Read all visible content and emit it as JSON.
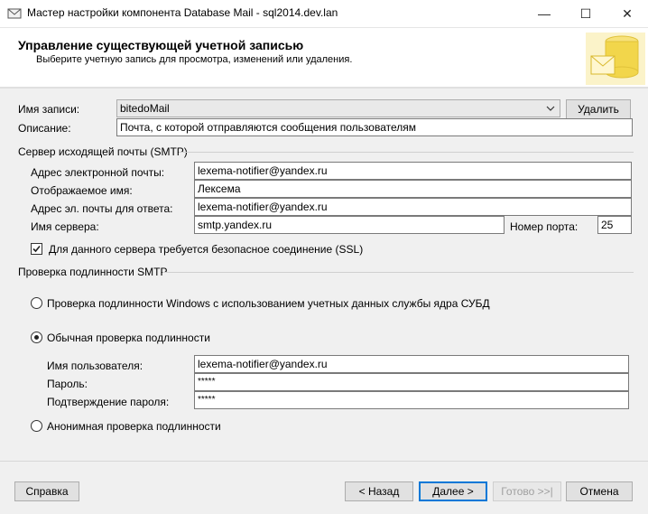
{
  "window": {
    "title": "Мастер настройки компонента Database Mail - sql2014.dev.lan",
    "minimize_glyph": "—",
    "maximize_glyph": "☐",
    "close_glyph": "✕"
  },
  "header": {
    "title": "Управление существующей учетной записью",
    "subtitle": "Выберите учетную запись для просмотра, изменений или удаления."
  },
  "account": {
    "name_label": "Имя записи:",
    "name_value": "bitedoMail",
    "delete_label": "Удалить",
    "description_label": "Описание:",
    "description_value": "Почта, с которой отправляются сообщения пользователям"
  },
  "smtp": {
    "group_label": "Сервер исходящей почты (SMTP)",
    "email_label": "Адрес электронной почты:",
    "email_value": "lexema-notifier@yandex.ru",
    "display_name_label": "Отображаемое имя:",
    "display_name_value": "Лексема",
    "reply_label": "Адрес эл. почты для ответа:",
    "reply_value": "lexema-notifier@yandex.ru",
    "server_label": "Имя сервера:",
    "server_value": "smtp.yandex.ru",
    "port_label": "Номер порта:",
    "port_value": "25",
    "ssl_label": "Для данного сервера требуется безопасное соединение (SSL)",
    "ssl_checked": true
  },
  "auth": {
    "group_label": "Проверка подлинности SMTP",
    "windows_label": "Проверка подлинности Windows с использованием учетных данных службы ядра СУБД",
    "basic_label": "Обычная проверка подлинности",
    "selected": "basic",
    "username_label": "Имя пользователя:",
    "username_value": "lexema-notifier@yandex.ru",
    "password_label": "Пароль:",
    "password_value": "*****",
    "confirm_label": "Подтверждение пароля:",
    "confirm_value": "*****",
    "anonymous_label": "Анонимная проверка подлинности"
  },
  "footer": {
    "help_label": "Справка",
    "back_label": "< Назад",
    "next_label": "Далее >",
    "finish_label": "Готово >>|",
    "cancel_label": "Отмена"
  },
  "colors": {
    "accent": "#0078d7",
    "panel_bg": "#f0f0f0",
    "art_yellow": "#f2d64b"
  }
}
